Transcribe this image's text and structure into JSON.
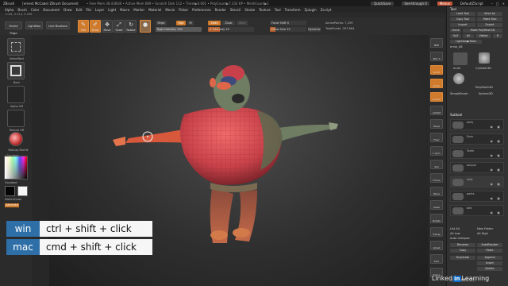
{
  "titlebar": {
    "app": "ZBrush",
    "doc": "[ernest McCabe]  ZBrush Document",
    "stats": "• Free Mem 38.436GB • Active Mem 689 • Scratch Disk 112 • Timer▶0.001 • PolyCount▶7.232 KP • MeshCount▶1",
    "quicksave": "QuickSave",
    "seethrough": "See-through  0",
    "menus": "Menus",
    "script": "DefaultZScript"
  },
  "menubar": [
    "Alpha",
    "Brush",
    "Color",
    "Document",
    "Draw",
    "Edit",
    "File",
    "Layer",
    "Light",
    "Macro",
    "Marker",
    "Material",
    "Movie",
    "Picker",
    "Preferences",
    "Render",
    "Stencil",
    "Stroke",
    "Texture",
    "Tool",
    "Transform",
    "Zplugin",
    "Zscript"
  ],
  "statusline": "-0.63, 4.124, 0.206",
  "toolbar": {
    "home_page": "Home Page",
    "lightbox": "LightBox",
    "live_boolean": "Live Boolean",
    "edit": "Edit",
    "draw": "Draw",
    "move": "Move",
    "scale": "Scale",
    "rotate": "Rotate",
    "mrgb": "Mrgb",
    "rgb": "Rgb",
    "m": "M",
    "rgb_intensity": "Rgb Intensity 100",
    "rgb_intensity_value": 100,
    "zadd": "Zadd",
    "zsub": "Zsub",
    "zcut": "Zcut",
    "z_intensity": "Z Intensity 25",
    "z_intensity_value": 25,
    "focal_shift": "Focal Shift 0",
    "draw_size": "Draw Size 15",
    "draw_size_value": 15,
    "dynamic": "Dynamic",
    "active_points": "ActivePoints: 7,259",
    "total_points": "TotalPoints: 267.664"
  },
  "leftshelf": {
    "slots": [
      "SelectRect",
      "Bern",
      "Alpha Off",
      "Texture Off",
      "MatCap Red W"
    ],
    "gradient": "Gradient",
    "switch_color": "SwitchColor",
    "alternate": "Alternate",
    "main_color": "#050505",
    "secondary_color": "#f7f7f7"
  },
  "rightshelf": [
    "BPR",
    "SPix 3",
    "Scroll",
    "Zoom",
    "Actual",
    "AAHalf",
    "Persp",
    "Floor",
    "L.Sym",
    "Xyz",
    "Frame",
    "Move",
    "Scale",
    "Rotate",
    "Transp",
    "Ghost",
    "Solo",
    "Xpose"
  ],
  "toolpanel": {
    "title": "Tool",
    "load_tool": "Load Tool",
    "save_as": "Save As",
    "copy_tool": "Copy Tool",
    "paste_tool": "Paste Tool",
    "import": "Import",
    "export": "Export",
    "clone": "Clone",
    "make_polymesh": "Make PolyMesh3D",
    "goz": "GoZ",
    "all": "All",
    "visible": "Visible",
    "r": "R",
    "lightbox_tools": "Lightbox▶Tools",
    "tool_name": "ernie_48",
    "tool_count": "48",
    "tools": [
      "ernie",
      "Cylinder3D",
      "PolyMesh3D",
      "SimpleBrush",
      "Sphere3D",
      "Ernie"
    ],
    "subtool_title": "Subtool",
    "subtools": [
      "body",
      "Eyes",
      "Teeth",
      "tongue",
      "shirt",
      "pants",
      "belt"
    ],
    "list_all": "List All",
    "new_folder": "New Folder",
    "all_low": "All Low",
    "all_high": "All High",
    "auto_collapse": "Auto Collapse",
    "rename": "Rename",
    "autoreorder": "AutoReorder",
    "copy": "Copy",
    "paste": "Paste",
    "duplicate": "Duplicate",
    "append": "Append",
    "insert": "Insert",
    "delete": "Delete",
    "split": "Split"
  },
  "shortcuts": [
    {
      "os": "win",
      "keys": "ctrl + shift + click"
    },
    {
      "os": "mac",
      "keys": "cmd + shift + click"
    }
  ],
  "watermark": {
    "brand": "Linked",
    "in": "in",
    "suffix": " Learning"
  }
}
